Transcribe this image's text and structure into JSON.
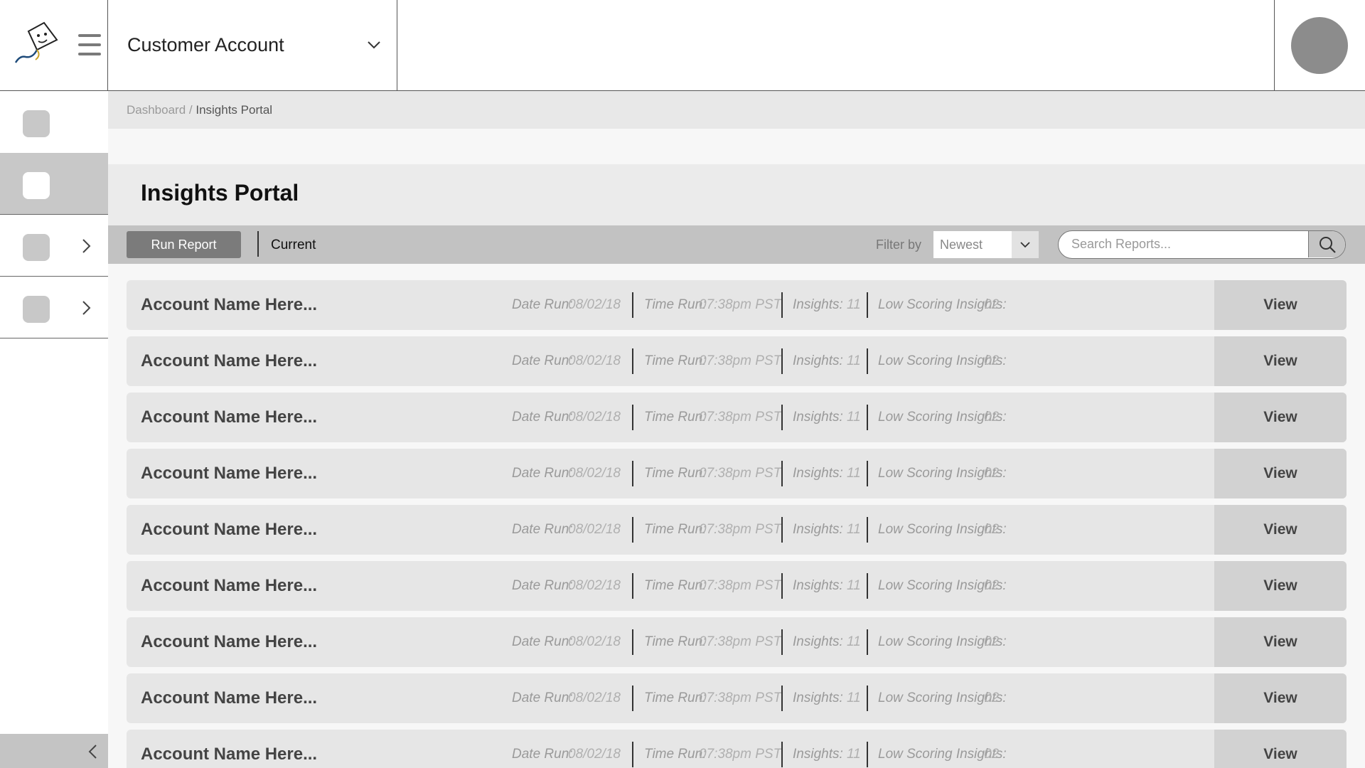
{
  "header": {
    "account_selector": "Customer Account"
  },
  "breadcrumb": {
    "parent": "Dashboard",
    "separator": " / ",
    "current": "Insights Portal"
  },
  "page": {
    "title": "Insights Portal"
  },
  "toolbar": {
    "run_report_label": "Run Report",
    "current_label": "Current",
    "filter_label": "Filter by",
    "filter_value": "Newest",
    "search_placeholder": "Search Reports..."
  },
  "row_labels": {
    "date_run": "Date Run:",
    "time_run": "Time Run:",
    "insights": "Insights:",
    "low_scoring": "Low Scoring Insights:",
    "view": "View"
  },
  "reports": [
    {
      "account": "Account Name Here...",
      "date_run": "08/02/18",
      "time_run": "07:38pm PST",
      "insights": "11",
      "low_scoring": "02"
    },
    {
      "account": "Account Name Here...",
      "date_run": "08/02/18",
      "time_run": "07:38pm PST",
      "insights": "11",
      "low_scoring": "02"
    },
    {
      "account": "Account Name Here...",
      "date_run": "08/02/18",
      "time_run": "07:38pm PST",
      "insights": "11",
      "low_scoring": "02"
    },
    {
      "account": "Account Name Here...",
      "date_run": "08/02/18",
      "time_run": "07:38pm PST",
      "insights": "11",
      "low_scoring": "02"
    },
    {
      "account": "Account Name Here...",
      "date_run": "08/02/18",
      "time_run": "07:38pm PST",
      "insights": "11",
      "low_scoring": "02"
    },
    {
      "account": "Account Name Here...",
      "date_run": "08/02/18",
      "time_run": "07:38pm PST",
      "insights": "11",
      "low_scoring": "02"
    },
    {
      "account": "Account Name Here...",
      "date_run": "08/02/18",
      "time_run": "07:38pm PST",
      "insights": "11",
      "low_scoring": "02"
    },
    {
      "account": "Account Name Here...",
      "date_run": "08/02/18",
      "time_run": "07:38pm PST",
      "insights": "11",
      "low_scoring": "02"
    },
    {
      "account": "Account Name Here...",
      "date_run": "08/02/18",
      "time_run": "07:38pm PST",
      "insights": "11",
      "low_scoring": "02"
    }
  ],
  "icons": {
    "logo": "kite-mascot-logo",
    "menu": "hamburger-menu-icon",
    "account_dropdown": "chevron-down-icon",
    "avatar": "user-avatar",
    "sidebar_expand": "chevron-right-icon",
    "sidebar_collapse": "chevron-left-icon",
    "search": "search-icon"
  },
  "colors": {
    "toolbar_bg": "#c2c2c2",
    "run_button_bg": "#7b7b7b",
    "row_bg": "#e6e6e6",
    "view_button_bg": "#d2d2d2",
    "sidebar_active_bg": "#c8c8c8"
  }
}
